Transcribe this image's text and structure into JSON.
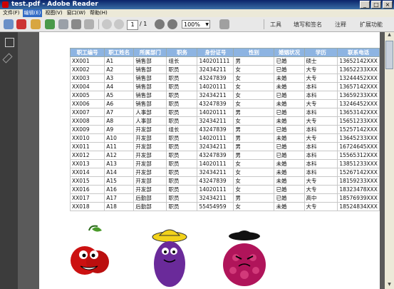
{
  "window": {
    "title": "test.pdf - Adobe Reader",
    "controls": [
      "_",
      "□",
      "×"
    ]
  },
  "menu": [
    "文件(F)",
    "编辑(E)",
    "视图(V)",
    "窗口(W)",
    "帮助(H)"
  ],
  "toolbar": {
    "page_current": "1",
    "page_total": "/ 1",
    "zoom": "100%",
    "tools": "工具",
    "sign": "填写和签名",
    "comment": "注释",
    "extend": "扩展功能"
  },
  "table": {
    "headers": [
      "职工编号",
      "职工姓名",
      "所属部门",
      "职务",
      "身份证号",
      "性别",
      "婚姻状况",
      "学历",
      "联系电话"
    ],
    "rows": [
      [
        "XX001",
        "A1",
        "销售部",
        "组长",
        "140201111",
        "男",
        "已婚",
        "硕士",
        "13652142XXX"
      ],
      [
        "XX002",
        "A2",
        "销售部",
        "职员",
        "32434211",
        "女",
        "已婚",
        "大专",
        "13652233XXX"
      ],
      [
        "XX003",
        "A3",
        "销售部",
        "职员",
        "43247839",
        "女",
        "未婚",
        "大专",
        "13244452XXX"
      ],
      [
        "XX004",
        "A4",
        "销售部",
        "职员",
        "14020111",
        "女",
        "未婚",
        "本科",
        "13657142XXX"
      ],
      [
        "XX005",
        "A5",
        "销售部",
        "职员",
        "32434211",
        "女",
        "已婚",
        "本科",
        "13659233XXX"
      ],
      [
        "XX006",
        "A6",
        "销售部",
        "职员",
        "43247839",
        "女",
        "未婚",
        "大专",
        "13246452XXX"
      ],
      [
        "XX007",
        "A7",
        "人事部",
        "职员",
        "14020111",
        "男",
        "已婚",
        "本科",
        "13653142XXX"
      ],
      [
        "XX008",
        "A8",
        "人事部",
        "职员",
        "32434211",
        "女",
        "未婚",
        "大专",
        "15651233XXX"
      ],
      [
        "XX009",
        "A9",
        "开发部",
        "组长",
        "43247839",
        "男",
        "已婚",
        "本科",
        "15257142XXX"
      ],
      [
        "XX010",
        "A10",
        "开发部",
        "职员",
        "14020111",
        "男",
        "未婚",
        "大专",
        "13645233XXX"
      ],
      [
        "XX011",
        "A11",
        "开发部",
        "职员",
        "32434211",
        "男",
        "已婚",
        "本科",
        "16724645XXX"
      ],
      [
        "XX012",
        "A12",
        "开发部",
        "职员",
        "43247839",
        "男",
        "已婚",
        "本科",
        "15565312XXX"
      ],
      [
        "XX013",
        "A13",
        "开发部",
        "职员",
        "14020111",
        "女",
        "未婚",
        "本科",
        "13851233XXX"
      ],
      [
        "XX014",
        "A14",
        "开发部",
        "职员",
        "32434211",
        "女",
        "未婚",
        "本科",
        "15267142XXX"
      ],
      [
        "XX015",
        "A15",
        "开发部",
        "职员",
        "43247839",
        "女",
        "未婚",
        "大专",
        "18159233XXX"
      ],
      [
        "XX016",
        "A16",
        "开发部",
        "职员",
        "14020111",
        "女",
        "已婚",
        "大专",
        "18323478XXX"
      ],
      [
        "XX017",
        "A17",
        "后勤部",
        "职员",
        "32434211",
        "男",
        "已婚",
        "高中",
        "18576939XXX"
      ],
      [
        "XX018",
        "A18",
        "后勤部",
        "职员",
        "55454959",
        "女",
        "未婚",
        "大专",
        "18524834XXX"
      ]
    ]
  },
  "colors": {
    "header_bg": "#8db4e2",
    "titlebar": "#0a246a",
    "doc_bg": "#5a5a5a"
  }
}
